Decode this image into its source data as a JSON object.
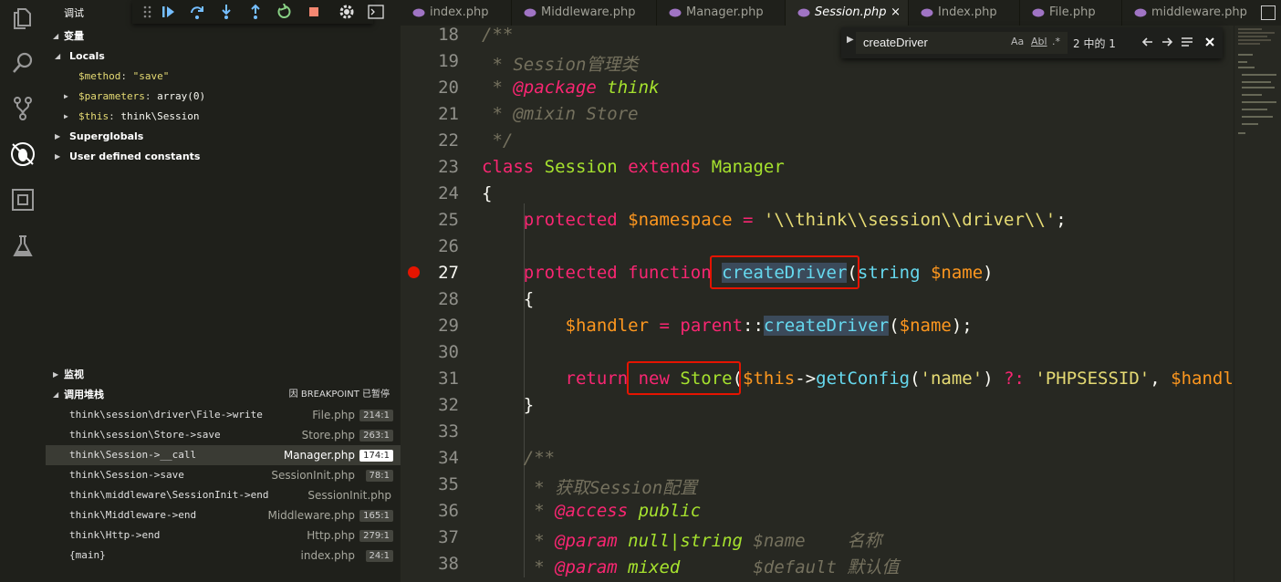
{
  "sidebar": {
    "title": "调试",
    "variables_title": "变量",
    "locals_title": "Locals",
    "locals": [
      {
        "name": "$method",
        "value": "\"save\""
      },
      {
        "name": "$parameters",
        "value": "array(0)"
      },
      {
        "name": "$this",
        "value": "think\\Session"
      }
    ],
    "superglobals": "Superglobals",
    "user_constants": "User defined constants",
    "watch_title": "监视",
    "callstack_title": "调用堆栈",
    "callstack_status": "因 BREAKPOINT 已暂停",
    "callstack": [
      {
        "fn": "think\\session\\driver\\File->write",
        "file": "File.php",
        "line": "214:1"
      },
      {
        "fn": "think\\session\\Store->save",
        "file": "Store.php",
        "line": "263:1"
      },
      {
        "fn": "think\\Session->__call",
        "file": "Manager.php",
        "line": "174:1"
      },
      {
        "fn": "think\\Session->save",
        "file": "SessionInit.php",
        "line": "78:1"
      },
      {
        "fn": "think\\middleware\\SessionInit->end",
        "file": "SessionInit.php",
        "line": ""
      },
      {
        "fn": "think\\Middleware->end",
        "file": "Middleware.php",
        "line": "165:1"
      },
      {
        "fn": "think\\Http->end",
        "file": "Http.php",
        "line": "279:1"
      },
      {
        "fn": "{main}",
        "file": "index.php",
        "line": "24:1"
      }
    ]
  },
  "tabs": [
    {
      "label": "index.php"
    },
    {
      "label": "Middleware.php"
    },
    {
      "label": "Manager.php"
    },
    {
      "label": "Session.php"
    },
    {
      "label": "Index.php"
    },
    {
      "label": "File.php"
    },
    {
      "label": "middleware.php"
    }
  ],
  "active_tab_close": "×",
  "find": {
    "query": "createDriver",
    "opt_case": "Aa",
    "opt_word": "Abl",
    "opt_regex": ".*",
    "count": "2 中的 1"
  },
  "editor": {
    "line_numbers": [
      "18",
      "19",
      "20",
      "21",
      "22",
      "23",
      "24",
      "25",
      "26",
      "27",
      "28",
      "29",
      "30",
      "31",
      "32",
      "33",
      "34",
      "35",
      "36",
      "37",
      "38"
    ],
    "comment_title": " * Session管理类",
    "package_tag": "@package",
    "package_name": "think",
    "mixin": " * @mixin Store",
    "comment_end": " */",
    "namespace_value": "'\\\\think\\\\session\\\\driver\\\\'",
    "store_default": "'PHPSESSID'",
    "doc2_title": "获取Session配置",
    "doc2_access": "@access",
    "doc2_public": "public",
    "doc2_param": "@param",
    "doc2_type1": "null|string",
    "doc2_var1": "$name",
    "doc2_desc1": "名称",
    "doc2_type2": "mixed",
    "doc2_var2": "$default",
    "doc2_desc2": "默认值"
  },
  "colors": {
    "breakpoint": "#e51400",
    "highlight_box": "#e51400"
  }
}
